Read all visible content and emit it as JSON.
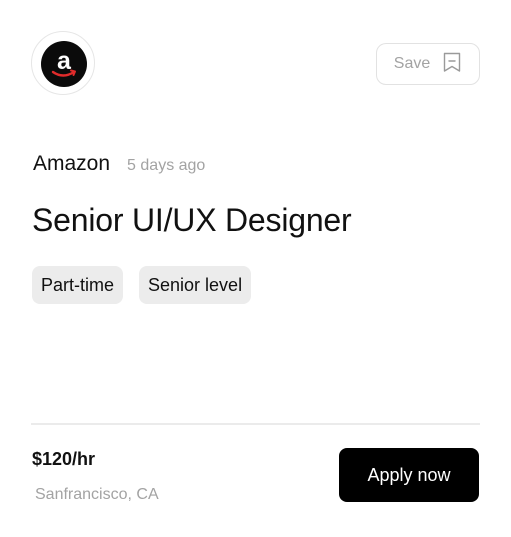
{
  "header": {
    "logo_icon": "amazon-logo-icon",
    "save_label": "Save",
    "save_icon": "bookmark-icon"
  },
  "job": {
    "company": "Amazon",
    "posted": "5 days ago",
    "title": "Senior UI/UX Designer",
    "tags": [
      "Part-time",
      "Senior level"
    ]
  },
  "footer": {
    "rate": "$120/hr",
    "location": "Sanfrancisco, CA",
    "apply_label": "Apply now"
  },
  "colors": {
    "primary_button": "#000000",
    "muted_text": "#a3a3a3",
    "tag_background": "#ececec",
    "brand_smile": "#e02b2b"
  }
}
